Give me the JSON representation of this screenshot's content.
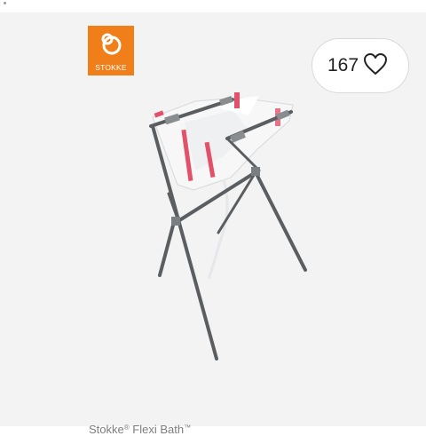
{
  "brand": {
    "name": "STOKKE",
    "color": "#f07f1a",
    "logo_icon": "stokke-logo-icon"
  },
  "like": {
    "count": "167",
    "icon": "heart-outline-icon"
  },
  "product": {
    "image_icon": "bath-stand-image",
    "caption_brand": "Stokke",
    "caption_product": "Flexi Bath",
    "caption_reg": "®",
    "caption_tm": "™",
    "frame_color": "#5b5e61",
    "accent_color": "#e3506a"
  }
}
